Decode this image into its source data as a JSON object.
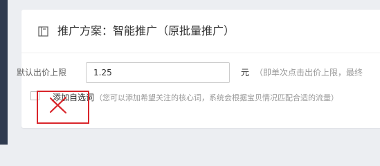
{
  "plan": {
    "title": "推广方案：智能推广（原批量推广）",
    "icon": "document-icon"
  },
  "bid": {
    "label": "默认出价上限",
    "value": "1.25",
    "unit": "元",
    "hint": "（即单次点击出价上限，最终"
  },
  "self_select": {
    "label": "添加自选词",
    "hint": "（您可以添加希望关注的核心词，系统会根据宝贝情况匹配合适的流量）",
    "checked": false
  },
  "annotation": {
    "color": "#d9252b",
    "mark": "red-x-mark"
  }
}
